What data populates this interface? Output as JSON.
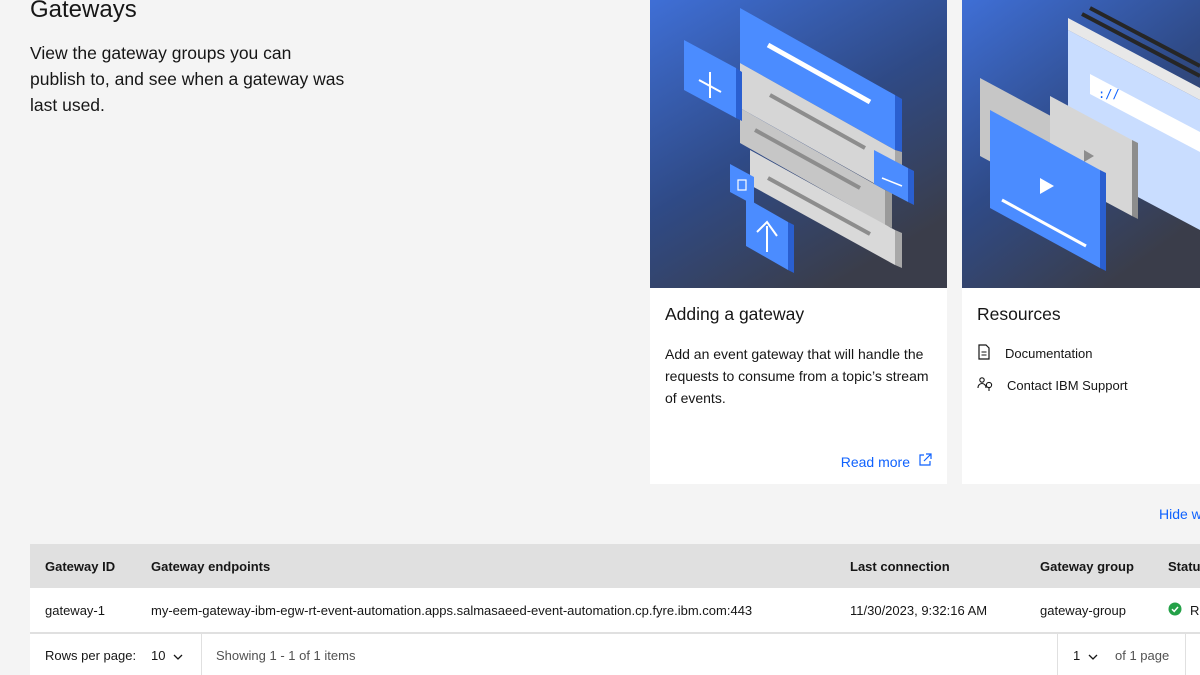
{
  "header": {
    "title": "Gateways",
    "description": "View the gateway groups you can publish to, and see when a gateway was last used."
  },
  "cards": {
    "adding": {
      "title": "Adding a gateway",
      "body": "Add an event gateway that will handle the requests to consume from a topic’s stream of events.",
      "link": "Read more"
    },
    "resources": {
      "title": "Resources",
      "items": [
        {
          "label": "Documentation",
          "icon": "document-icon"
        },
        {
          "label": "Contact IBM Support",
          "icon": "support-icon"
        }
      ]
    }
  },
  "hide_link": "Hide w",
  "table": {
    "headers": {
      "gateway_id": "Gateway ID",
      "endpoints": "Gateway endpoints",
      "last_connection": "Last connection",
      "group": "Gateway group",
      "status": "Statu"
    },
    "rows": [
      {
        "gateway_id": "gateway-1",
        "endpoints": "my-eem-gateway-ibm-egw-rt-event-automation.apps.salmasaeed-event-automation.cp.fyre.ibm.com:443",
        "last_connection": "11/30/2023, 9:32:16 AM",
        "group": "gateway-group",
        "status": "R"
      }
    ],
    "footer": {
      "rows_per_page_label": "Rows per page:",
      "rows_per_page_value": "10",
      "showing": "Showing 1 - 1 of 1 items",
      "page_value": "1",
      "of_pages": "of 1 page"
    }
  },
  "colors": {
    "accent": "#0f62fe",
    "success": "#24a148",
    "illustration_blue": "#4589ff"
  }
}
